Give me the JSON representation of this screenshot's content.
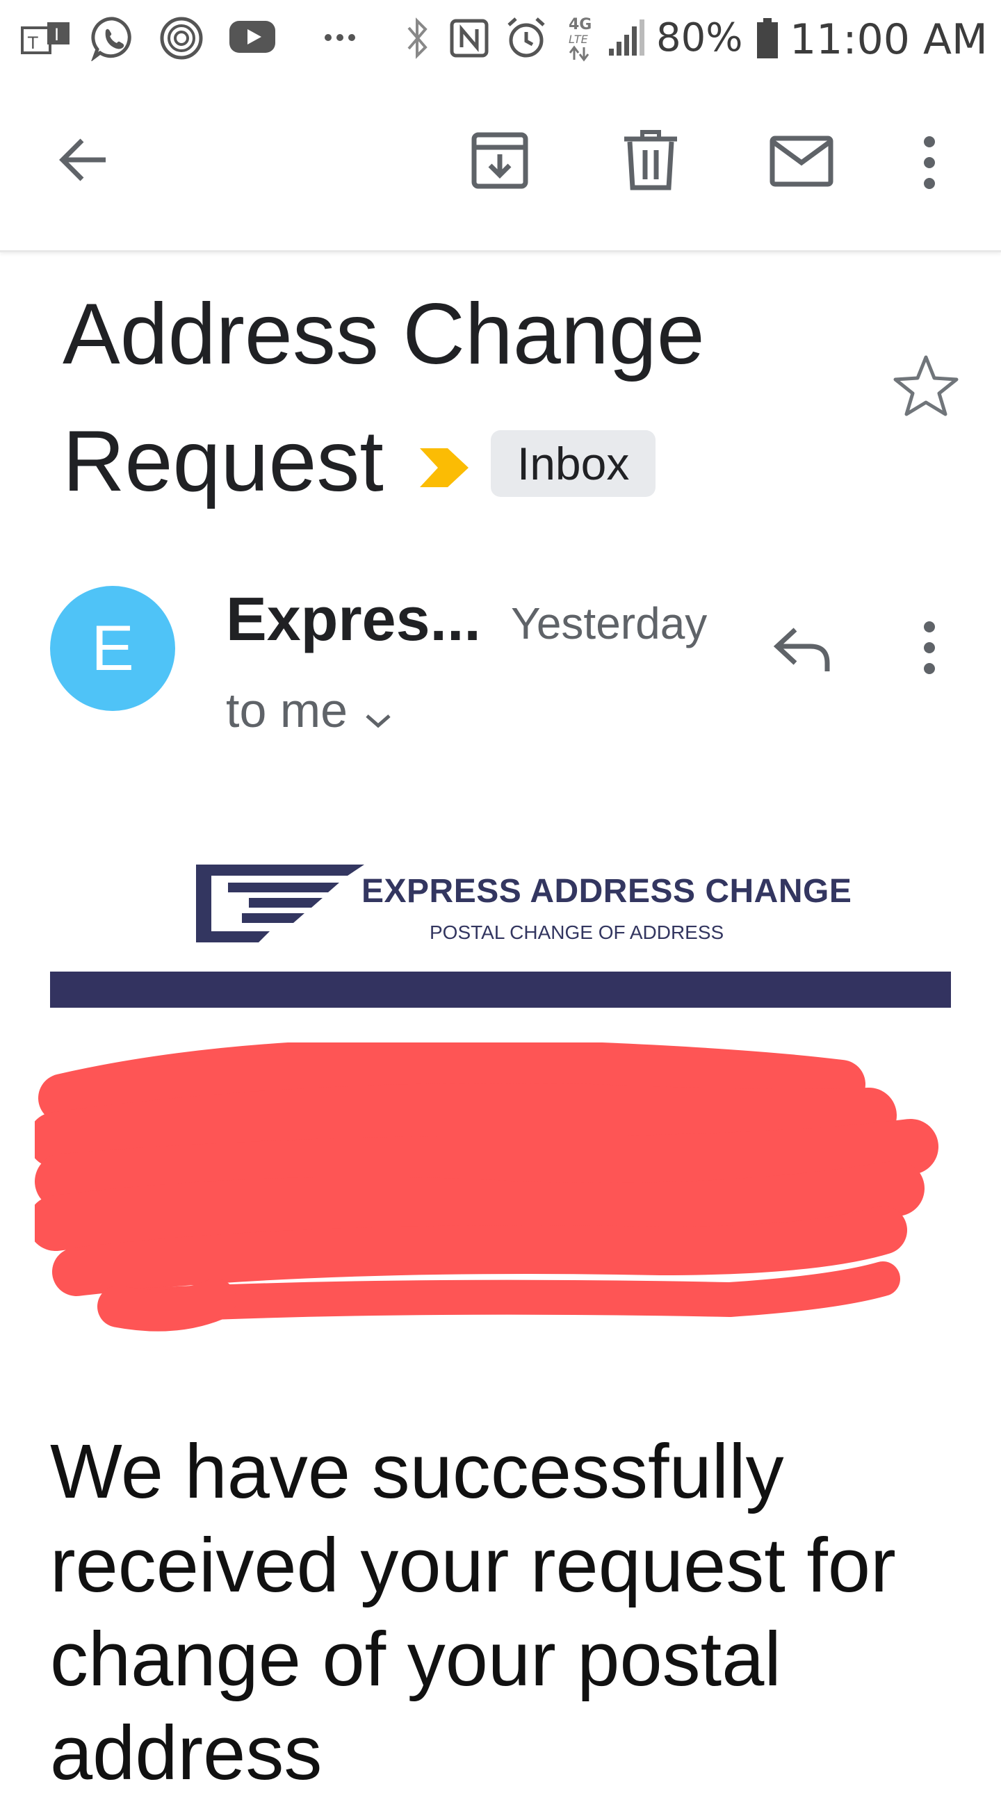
{
  "status_bar": {
    "battery_percent": "80%",
    "time": "11:00 AM",
    "network": "4G LTE",
    "icons": [
      "teams-icon",
      "whatsapp-icon",
      "threads-icon",
      "youtube-icon",
      "more-dots-icon",
      "bluetooth-icon",
      "nfc-icon",
      "alarm-icon",
      "signal-icon",
      "battery-icon"
    ]
  },
  "toolbar": {
    "icons": [
      "back-arrow-icon",
      "archive-icon",
      "delete-icon",
      "mark-unread-icon",
      "more-vert-icon"
    ]
  },
  "email": {
    "subject": "Address Change Request",
    "label": "Inbox",
    "sender": "Expres...",
    "sender_initial": "E",
    "date": "Yesterday",
    "recipients": "to me",
    "body_text": "We have successfully received your request for change of your postal address"
  },
  "logo": {
    "title": "EXPRESS ADDRESS CHANGE",
    "subtitle": "POSTAL CHANGE OF ADDRESS"
  },
  "colors": {
    "avatar": "#4fc3f7",
    "importance_marker": "#fbbc04",
    "brand_navy": "#333360",
    "redaction": "#fe5555"
  }
}
